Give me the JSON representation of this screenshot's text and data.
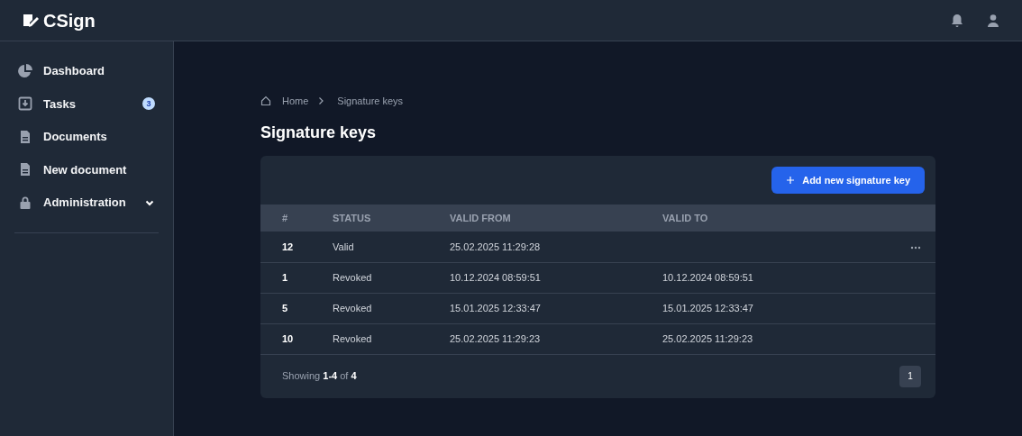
{
  "app": {
    "name": "CSign"
  },
  "sidebar": {
    "items": [
      {
        "label": "Dashboard",
        "expandable": false
      },
      {
        "label": "Tasks",
        "badge": "3",
        "expandable": false
      },
      {
        "label": "Documents",
        "expandable": false
      },
      {
        "label": "New document",
        "expandable": false
      },
      {
        "label": "Administration",
        "expandable": true
      }
    ]
  },
  "breadcrumb": [
    "Home",
    "Signature keys"
  ],
  "page_title": "Signature keys",
  "add_button": "Add new signature key",
  "table": {
    "columns": [
      "#",
      "STATUS",
      "VALID FROM",
      "VALID TO"
    ],
    "rows": [
      {
        "cells": [
          "12",
          "Valid",
          "25.02.2025 11:29:28",
          ""
        ],
        "actions_menu": true
      },
      {
        "cells": [
          "1",
          "Revoked",
          "10.12.2024 08:59:51",
          "10.12.2024 08:59:51"
        ],
        "actions_menu": false
      },
      {
        "cells": [
          "5",
          "Revoked",
          "15.01.2025 12:33:47",
          "15.01.2025 12:33:47"
        ],
        "actions_menu": false
      },
      {
        "cells": [
          "10",
          "Revoked",
          "25.02.2025 11:29:23",
          "25.02.2025 11:29:23"
        ],
        "actions_menu": false
      }
    ]
  },
  "footer": {
    "summary": "Showing **1-4** of **4**",
    "pages": [
      {
        "label": "1",
        "selected": true
      }
    ]
  }
}
